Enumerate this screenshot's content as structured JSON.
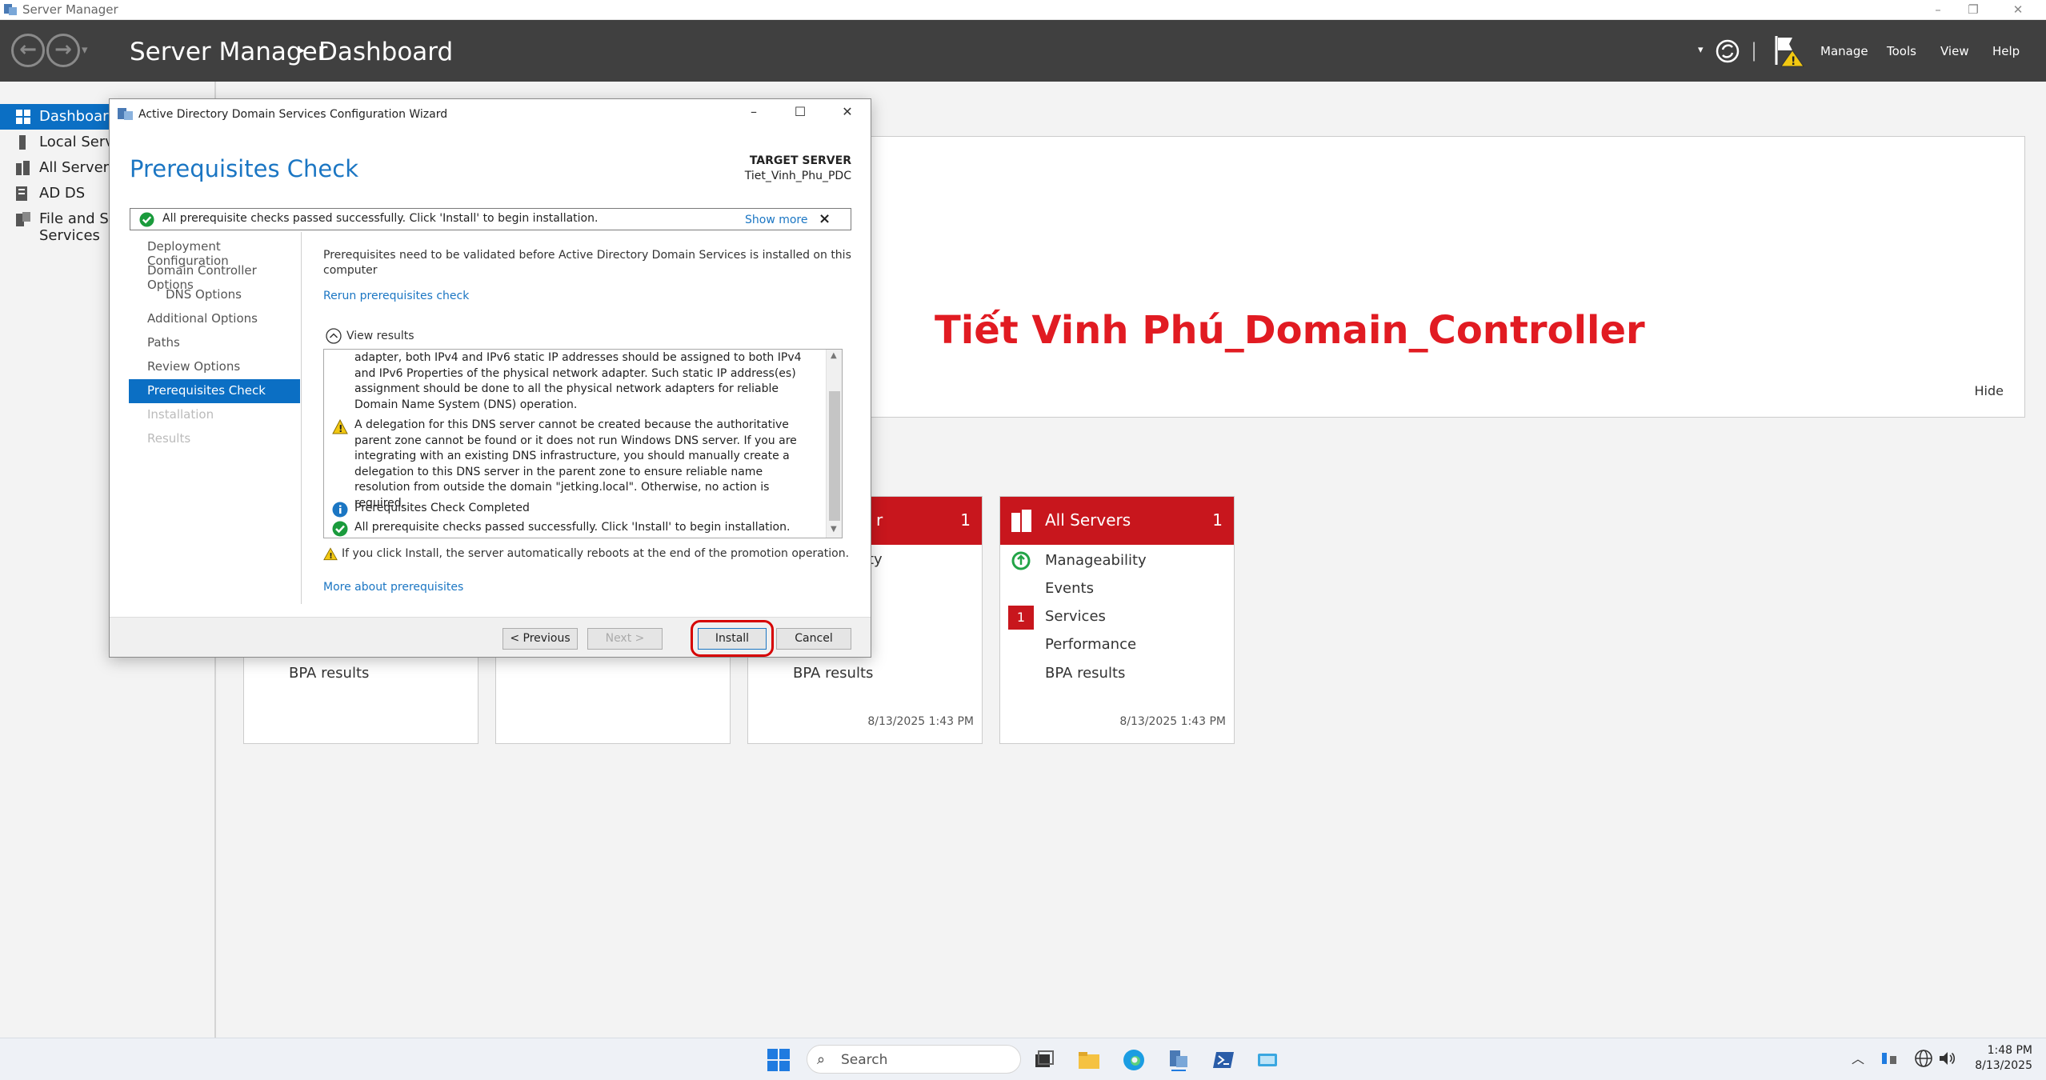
{
  "window": {
    "title": "Server Manager"
  },
  "header": {
    "app": "Server Manager",
    "separator": "▸",
    "page": "Dashboard",
    "menu": [
      "Manage",
      "Tools",
      "View",
      "Help"
    ]
  },
  "sidebar": {
    "items": [
      {
        "label": "Dashboard"
      },
      {
        "label": "Local Server"
      },
      {
        "label": "All Servers"
      },
      {
        "label": "AD DS"
      },
      {
        "label": "File and Storage Services"
      }
    ]
  },
  "welcome": {
    "title": "Tiết Vinh Phú_Domain_Controller",
    "hide": "Hide"
  },
  "tiles": [
    {
      "rows": [
        "BPA results"
      ]
    },
    {
      "rows": []
    },
    {
      "name": "r",
      "count": "1",
      "rows": [
        "ty",
        "BPA results"
      ],
      "stamp": "8/13/2025 1:43 PM"
    },
    {
      "name": "All Servers",
      "count": "1",
      "rows": [
        "Manageability",
        "Events",
        "Services",
        "Performance",
        "BPA results"
      ],
      "badge": "1",
      "stamp": "8/13/2025 1:43 PM"
    }
  ],
  "dialog": {
    "title": "Active Directory Domain Services Configuration Wizard",
    "heading": "Prerequisites Check",
    "target_label": "TARGET SERVER",
    "target_value": "Tiet_Vinh_Phu_PDC",
    "notice": "All prerequisite checks passed successfully.  Click 'Install' to begin installation.",
    "show_more": "Show more",
    "close_glyph": "×",
    "steps": [
      "Deployment Configuration",
      "Domain Controller Options",
      "DNS Options",
      "Additional Options",
      "Paths",
      "Review Options",
      "Prerequisites Check",
      "Installation",
      "Results"
    ],
    "intro": "Prerequisites need to be validated before Active Directory Domain Services is installed on this computer",
    "rerun": "Rerun prerequisites check",
    "view_results": "View results",
    "results": {
      "r1": "adapter, both IPv4 and IPv6 static IP addresses should be assigned to both IPv4 and IPv6 Properties of the physical network adapter. Such static IP address(es) assignment should be done to all the physical network adapters for reliable Domain Name System (DNS) operation.",
      "r2": "A delegation for this DNS server cannot be created because the authoritative parent zone cannot be found or it does not run Windows DNS server. If you are integrating with an existing DNS infrastructure, you should manually create a delegation to this DNS server in the parent zone to ensure reliable name resolution from outside the domain \"jetking.local\". Otherwise, no action is required.",
      "r3": "Prerequisites Check Completed",
      "r4": "All prerequisite checks passed successfully.  Click 'Install' to begin installation."
    },
    "reboot_warning": "If you click Install, the server automatically reboots at the end of the promotion operation.",
    "more_link": "More about prerequisites",
    "buttons": {
      "previous": "< Previous",
      "next": "Next >",
      "install": "Install",
      "cancel": "Cancel"
    }
  },
  "taskbar": {
    "search_placeholder": "Search",
    "time": "1:48 PM",
    "date": "8/13/2025"
  },
  "colors": {
    "accent": "#0b6fc4",
    "tile_red": "#c8161d",
    "welcome_red": "#e11b22"
  }
}
